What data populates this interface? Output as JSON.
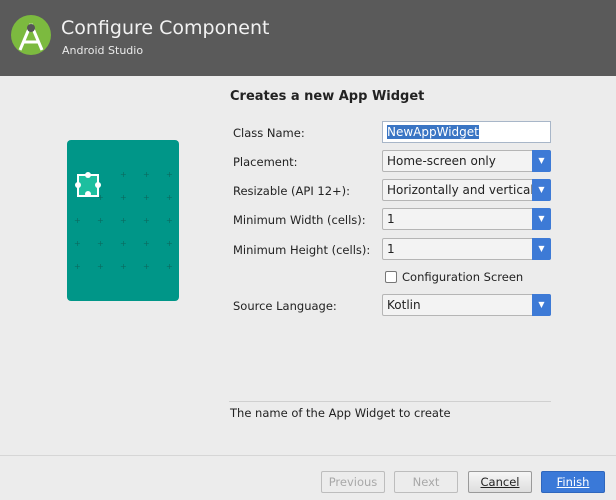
{
  "header": {
    "title": "Configure Component",
    "subtitle": "Android Studio"
  },
  "form": {
    "heading": "Creates a new App Widget",
    "class_name": {
      "label": "Class Name:",
      "value": "NewAppWidget"
    },
    "placement": {
      "label": "Placement:",
      "value": "Home-screen only"
    },
    "resizable": {
      "label": "Resizable (API 12+):",
      "value": "Horizontally and vertically"
    },
    "min_width": {
      "label": "Minimum Width (cells):",
      "value": "1"
    },
    "min_height": {
      "label": "Minimum Height (cells):",
      "value": "1"
    },
    "config_screen": {
      "label": "Configuration Screen",
      "checked": false
    },
    "source_language": {
      "label": "Source Language:",
      "value": "Kotlin"
    }
  },
  "description": "The name of the App Widget to create",
  "buttons": {
    "previous": "Previous",
    "next": "Next",
    "cancel": "Cancel",
    "finish": "Finish"
  },
  "colors": {
    "header": "#5a5a5a",
    "preview": "#009688",
    "accent": "#3a79d8"
  }
}
